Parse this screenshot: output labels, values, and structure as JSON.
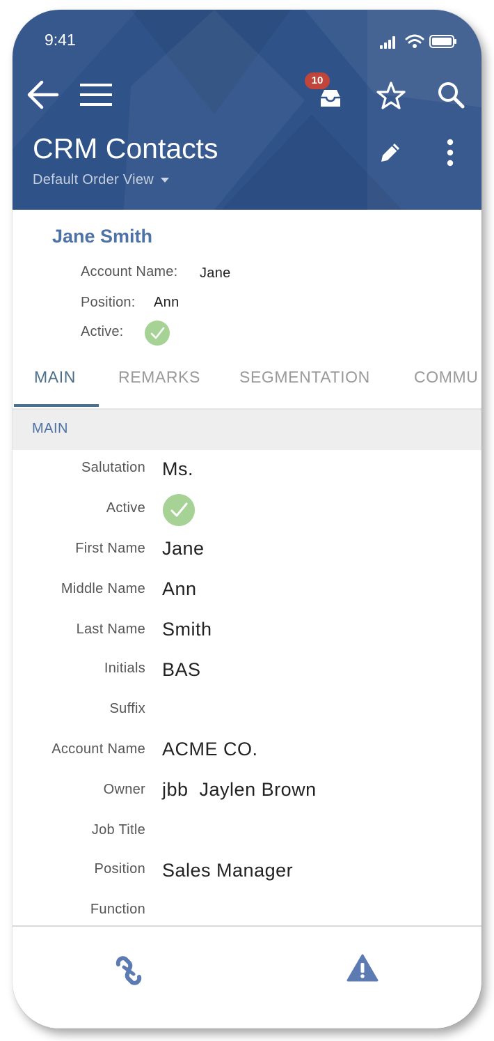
{
  "status_bar": {
    "time": "9:41"
  },
  "toolbar": {
    "back_icon": "arrow-left-icon",
    "menu_icon": "hamburger-menu-icon",
    "inbox_icon": "inbox-tray-icon",
    "inbox_badge": "10",
    "favorite_icon": "star-icon",
    "search_icon": "search-icon",
    "edit_icon": "pencil-icon",
    "more_icon": "vertical-dots-icon"
  },
  "header": {
    "title": "CRM Contacts",
    "view_selector": "Default Order View"
  },
  "summary": {
    "name": "Jane Smith",
    "fields": [
      {
        "label": "Account Name:",
        "value": "Jane"
      },
      {
        "label": "Position:",
        "value": "Ann"
      },
      {
        "label": "Active:",
        "value": true
      }
    ]
  },
  "tabs": [
    "MAIN",
    "REMARKS",
    "SEGMENTATION",
    "COMMU"
  ],
  "active_tab": "MAIN",
  "section": {
    "title": "MAIN"
  },
  "fields": [
    {
      "label": "Salutation",
      "value": "Ms."
    },
    {
      "label": "Active",
      "value": true
    },
    {
      "label": "First Name",
      "value": "Jane"
    },
    {
      "label": "Middle Name",
      "value": "Ann"
    },
    {
      "label": "Last Name",
      "value": "Smith"
    },
    {
      "label": "Initials",
      "value": "BAS"
    },
    {
      "label": "Suffix",
      "value": ""
    },
    {
      "label": "Account Name",
      "value": "ACME CO."
    },
    {
      "label": "Owner",
      "value": "jbb  Jaylen Brown"
    },
    {
      "label": "Job Title",
      "value": ""
    },
    {
      "label": "Position",
      "value": "Sales Manager"
    },
    {
      "label": "Function",
      "value": ""
    }
  ],
  "bottom_bar": {
    "links_icon": "chain-link-icon",
    "warning_icon": "warning-triangle-icon"
  },
  "colors": {
    "header_bg": "#2f5288",
    "accent": "#4d72a6",
    "active_check": "#a6d395",
    "badge": "#c0453a"
  }
}
